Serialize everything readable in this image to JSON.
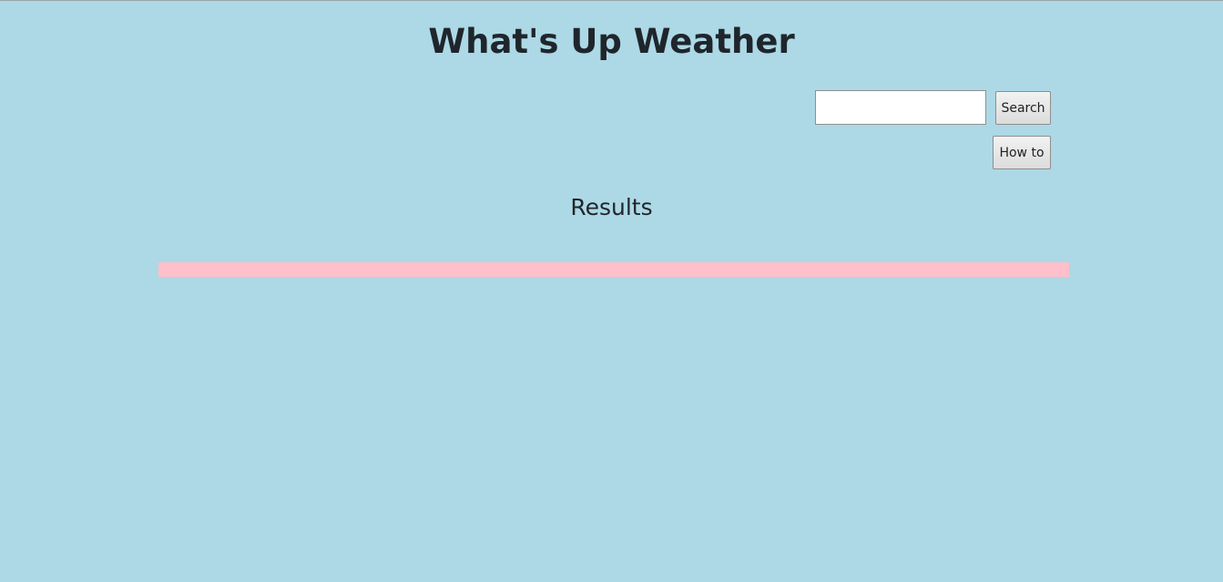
{
  "header": {
    "title": "What's Up Weather"
  },
  "search": {
    "value": "",
    "placeholder": "",
    "button_label": "Search"
  },
  "howto": {
    "button_label": "How to"
  },
  "results": {
    "heading": "Results"
  },
  "colors": {
    "background": "#add8e6",
    "results_bar": "#ffc0cb",
    "text": "#1f262b"
  }
}
